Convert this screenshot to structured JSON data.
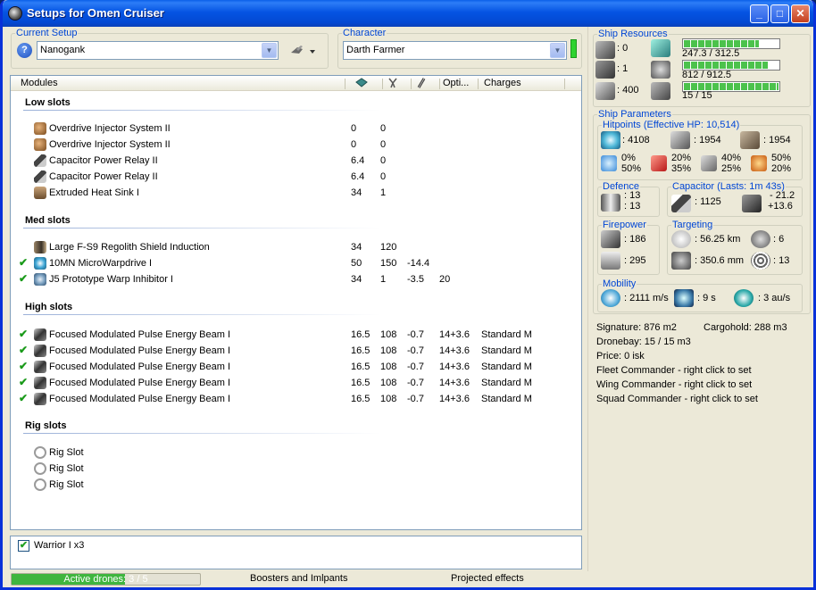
{
  "window": {
    "title": "Setups for Omen Cruiser"
  },
  "setup": {
    "legend": "Current Setup",
    "value": "Nanogank"
  },
  "character": {
    "legend": "Character",
    "value": "Darth Farmer",
    "status_color": "#2fd32f"
  },
  "modules_header": {
    "modules": "Modules",
    "opti": "Opti...",
    "charges": "Charges"
  },
  "sections": {
    "low": {
      "title": "Low slots",
      "rows": [
        {
          "name": "Overdrive Injector System II",
          "c1": "0",
          "c2": "0",
          "c3": "",
          "c4": "",
          "c5": "",
          "checked": false
        },
        {
          "name": "Overdrive Injector System II",
          "c1": "0",
          "c2": "0",
          "c3": "",
          "c4": "",
          "c5": "",
          "checked": false
        },
        {
          "name": "Capacitor Power Relay II",
          "c1": "6.4",
          "c2": "0",
          "c3": "",
          "c4": "",
          "c5": "",
          "checked": false
        },
        {
          "name": "Capacitor Power Relay II",
          "c1": "6.4",
          "c2": "0",
          "c3": "",
          "c4": "",
          "c5": "",
          "checked": false
        },
        {
          "name": "Extruded Heat Sink I",
          "c1": "34",
          "c2": "1",
          "c3": "",
          "c4": "",
          "c5": "",
          "checked": false
        }
      ]
    },
    "med": {
      "title": "Med slots",
      "rows": [
        {
          "name": "Large F-S9 Regolith Shield Induction",
          "c1": "34",
          "c2": "120",
          "c3": "",
          "c4": "",
          "c5": "",
          "checked": false
        },
        {
          "name": "10MN MicroWarpdrive I",
          "c1": "50",
          "c2": "150",
          "c3": "-14.4",
          "c4": "",
          "c5": "",
          "checked": true
        },
        {
          "name": "J5 Prototype Warp Inhibitor I",
          "c1": "34",
          "c2": "1",
          "c3": "-3.5",
          "c4": "20",
          "c5": "",
          "checked": true
        }
      ]
    },
    "high": {
      "title": "High slots",
      "rows": [
        {
          "name": "Focused Modulated Pulse Energy Beam I",
          "c1": "16.5",
          "c2": "108",
          "c3": "-0.7",
          "c4": "14+3.6",
          "c5": "Standard M",
          "checked": true
        },
        {
          "name": "Focused Modulated Pulse Energy Beam I",
          "c1": "16.5",
          "c2": "108",
          "c3": "-0.7",
          "c4": "14+3.6",
          "c5": "Standard M",
          "checked": true
        },
        {
          "name": "Focused Modulated Pulse Energy Beam I",
          "c1": "16.5",
          "c2": "108",
          "c3": "-0.7",
          "c4": "14+3.6",
          "c5": "Standard M",
          "checked": true
        },
        {
          "name": "Focused Modulated Pulse Energy Beam I",
          "c1": "16.5",
          "c2": "108",
          "c3": "-0.7",
          "c4": "14+3.6",
          "c5": "Standard M",
          "checked": true
        },
        {
          "name": "Focused Modulated Pulse Energy Beam I",
          "c1": "16.5",
          "c2": "108",
          "c3": "-0.7",
          "c4": "14+3.6",
          "c5": "Standard M",
          "checked": true
        }
      ]
    },
    "rig": {
      "title": "Rig slots",
      "rows": [
        {
          "name": "Rig Slot",
          "c1": "",
          "c2": "",
          "c3": "",
          "c4": "",
          "c5": "",
          "checked": false
        },
        {
          "name": "Rig Slot",
          "c1": "",
          "c2": "",
          "c3": "",
          "c4": "",
          "c5": "",
          "checked": false
        },
        {
          "name": "Rig Slot",
          "c1": "",
          "c2": "",
          "c3": "",
          "c4": "",
          "c5": "",
          "checked": false
        }
      ]
    }
  },
  "drones": {
    "label": "Warrior I x3",
    "checked": true
  },
  "statusbar": {
    "active_drones": "Active drones: 3 / 5",
    "active_fraction": 0.6,
    "boosters": "Boosters and Imlpants",
    "projected": "Projected effects"
  },
  "resources": {
    "legend": "Ship Resources",
    "hardpoints_turret": ": 0",
    "hardpoints_launcher": ": 1",
    "calibration": ": 400",
    "cpu": {
      "text": "247.3 / 312.5",
      "fraction": 0.79
    },
    "powergrid": {
      "text": "812 / 912.5",
      "fraction": 0.89
    },
    "drone_bandwidth": {
      "text": "15 / 15",
      "fraction": 1.0
    }
  },
  "parameters": {
    "legend": "Ship Parameters",
    "hitpoints_legend": "Hitpoints (Effective HP: 10,514)",
    "shield_hp": ": 4108",
    "armor_hp": ": 1954",
    "structure_hp": ": 1954",
    "res_em": [
      "0%",
      "50%"
    ],
    "res_thermal": [
      "20%",
      "35%"
    ],
    "res_kinetic": [
      "40%",
      "25%"
    ],
    "res_explosive": [
      "50%",
      "20%"
    ],
    "defence_legend": "Defence",
    "defence_values": [
      ": 13",
      ": 13"
    ],
    "capacitor_legend": "Capacitor (Lasts: 1m 43s)",
    "capacitor_amount": ": 1125",
    "capacitor_delta": [
      "- 21.2",
      "+13.6"
    ],
    "firepower_legend": "Firepower",
    "firepower_turret": ": 186",
    "firepower_missile": ": 295",
    "targeting_legend": "Targeting",
    "target_range": ": 56.25 km",
    "max_targets": ": 6",
    "scan_res": ": 350.6 mm",
    "sensor_strength": ": 13",
    "mobility_legend": "Mobility",
    "max_velocity": ": 2111 m/s",
    "align_time": ": 9 s",
    "warp_speed": ": 3 au/s"
  },
  "info": {
    "signature": "Signature: 876 m2",
    "cargohold": "Cargohold: 288 m3",
    "dronebay": "Dronebay: 15 / 15 m3",
    "price": "Price: 0 isk",
    "fleet": "Fleet Commander - right click to set",
    "wing": "Wing Commander - right click to set",
    "squad": "Squad Commander - right click to set"
  }
}
